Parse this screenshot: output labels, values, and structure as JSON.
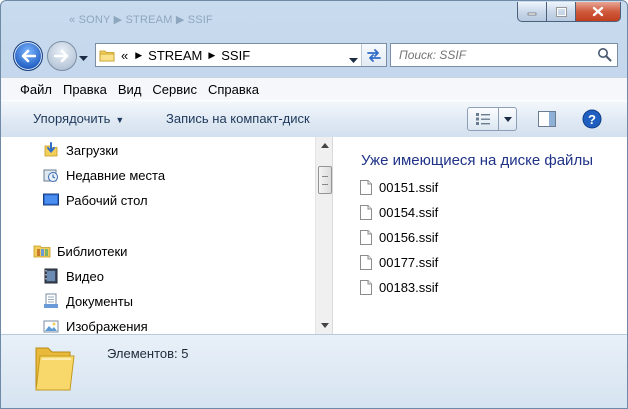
{
  "window": {
    "ghost_title": "« SONY ▶ STREAM ▶ SSIF",
    "minimize_icon": "minimize-icon",
    "maximize_icon": "maximize-icon",
    "close_icon": "close-icon"
  },
  "address": {
    "overflow": "«",
    "crumbs": [
      "STREAM",
      "SSIF"
    ],
    "search_placeholder": "Поиск: SSIF"
  },
  "menu": [
    "Файл",
    "Правка",
    "Вид",
    "Сервис",
    "Справка"
  ],
  "toolbar": {
    "organize": "Упорядочить",
    "burn": "Запись на компакт-диск"
  },
  "nav": {
    "favorites": [
      {
        "label": "Загрузки",
        "icon": "downloads-icon"
      },
      {
        "label": "Недавние места",
        "icon": "recent-places-icon"
      },
      {
        "label": "Рабочий стол",
        "icon": "desktop-icon"
      }
    ],
    "libraries_label": "Библиотеки",
    "libraries": [
      {
        "label": "Видео",
        "icon": "video-icon"
      },
      {
        "label": "Документы",
        "icon": "documents-icon"
      },
      {
        "label": "Изображения",
        "icon": "pictures-icon"
      }
    ]
  },
  "files": {
    "group_header": "Уже имеющиеся на диске файлы",
    "items": [
      "00151.ssif",
      "00154.ssif",
      "00156.ssif",
      "00177.ssif",
      "00183.ssif"
    ]
  },
  "details": {
    "count": "Элементов: 5"
  },
  "colors": {
    "group_header": "#1e3287",
    "frame": "#c9dbee",
    "close_button": "#c13e1e"
  }
}
